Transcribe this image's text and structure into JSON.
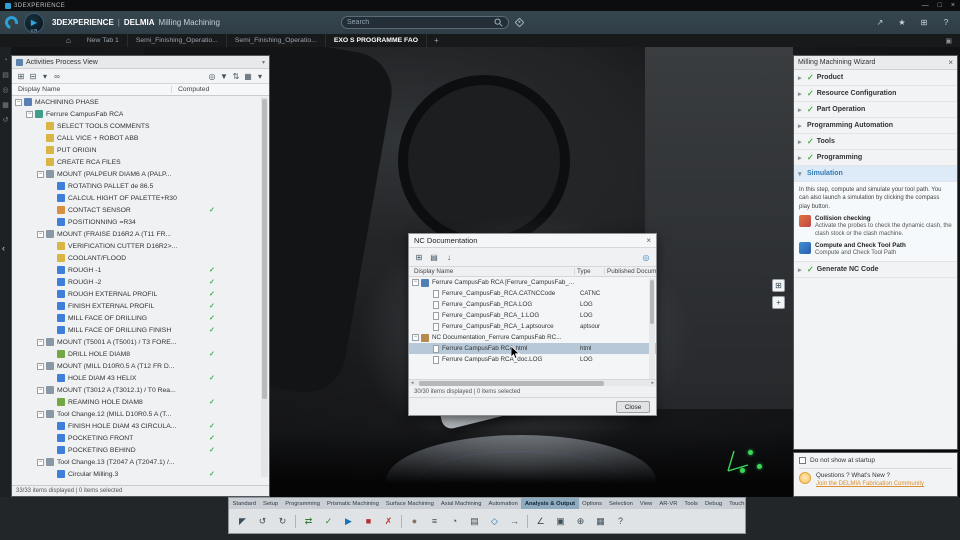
{
  "colors": {
    "accent": "#3a87c8",
    "check_green": "#3fae49",
    "selection": "#b7c9d8",
    "link_orange": "#d98e2b",
    "header_bg": "#37474f"
  },
  "titlebar": {
    "app_name": "3DEXPERIENCE",
    "window_controls": [
      {
        "name": "minimize-button",
        "glyph": "—"
      },
      {
        "name": "maximize-button",
        "glyph": "□"
      },
      {
        "name": "close-button",
        "glyph": "×"
      }
    ]
  },
  "header": {
    "brand": "3DEXPERIENCE",
    "separator": "|",
    "app": "DELMIA",
    "module": "Milling Machining",
    "compass_label": "V.R",
    "search_placeholder": "Search",
    "icons": [
      {
        "name": "share-icon",
        "glyph": "↗"
      },
      {
        "name": "favorites-icon",
        "glyph": "★"
      },
      {
        "name": "apps-grid-icon",
        "glyph": "⊞"
      },
      {
        "name": "help-icon",
        "glyph": "?"
      }
    ]
  },
  "tabbar": {
    "tabs": [
      {
        "label": "New Tab 1",
        "active": false
      },
      {
        "label": "Semi_Finishing_Operatio...",
        "active": false
      },
      {
        "label": "Semi_Finishing_Operatio...",
        "active": false
      },
      {
        "label": "EXO S PROGRAMME FAO",
        "active": true
      }
    ],
    "add_label": "+",
    "panel_toggle_glyph": "▣"
  },
  "edge_icons": [
    {
      "name": "compass-icon",
      "glyph": "◔"
    },
    {
      "name": "model-tree-icon",
      "glyph": "▤"
    },
    {
      "name": "search-panel-icon",
      "glyph": "◎"
    },
    {
      "name": "apps-panel-icon",
      "glyph": "▦"
    },
    {
      "name": "history-icon",
      "glyph": "↺"
    }
  ],
  "left_panel": {
    "title": "Activities Process View",
    "toolbar_left": [
      {
        "name": "insert-activity-icon",
        "glyph": "⊞"
      },
      {
        "name": "collapse-all-icon",
        "glyph": "⊟"
      },
      {
        "name": "view-mode-icon",
        "glyph": "▾"
      },
      {
        "name": "link-view-icon",
        "glyph": "∞"
      }
    ],
    "toolbar_right": [
      {
        "name": "search-icon",
        "glyph": "◎"
      },
      {
        "name": "filter-icon",
        "glyph": "▼"
      },
      {
        "name": "sort-icon",
        "glyph": "⇅"
      },
      {
        "name": "columns-icon",
        "glyph": "▦"
      },
      {
        "name": "panel-options-icon",
        "glyph": "▾"
      }
    ],
    "columns": {
      "display_name": "Display Name",
      "computed": "Computed"
    },
    "status": "33/33 items displayed | 0 items selected",
    "tree": [
      {
        "label": "MACHINING PHASE",
        "level": 0,
        "icon": "machining-phase-icon",
        "expand": true,
        "computed": false
      },
      {
        "label": "Ferrure CampusFab RCA",
        "level": 1,
        "icon": "program-icon",
        "expand": true,
        "computed": false
      },
      {
        "label": "SELECT TOOLS COMMENTS",
        "level": 2,
        "icon": "comment-icon",
        "expand": false,
        "computed": false
      },
      {
        "label": "CALL VICE + ROBOT ABB",
        "level": 2,
        "icon": "comment-icon",
        "expand": false,
        "computed": false
      },
      {
        "label": "PUT ORIGIN",
        "level": 2,
        "icon": "comment-icon",
        "expand": false,
        "computed": false
      },
      {
        "label": "CREATE RCA FILES",
        "level": 2,
        "icon": "comment-icon",
        "expand": false,
        "computed": false
      },
      {
        "label": "MOUNT (PALPEUR DIAM6 A (PALP...",
        "level": 2,
        "icon": "tool-change-icon",
        "expand": true,
        "computed": false
      },
      {
        "label": "ROTATING PALLET de 86.5",
        "level": 3,
        "icon": "operation-icon",
        "expand": false,
        "computed": false
      },
      {
        "label": "CALCUL HIGHT OF PALETTE+R30",
        "level": 3,
        "icon": "operation-icon",
        "expand": false,
        "computed": false
      },
      {
        "label": "CONTACT SENSOR",
        "level": 3,
        "icon": "probe-icon",
        "expand": false,
        "computed": true
      },
      {
        "label": "POSITIONNING =R34",
        "level": 3,
        "icon": "operation-icon",
        "expand": false,
        "computed": false
      },
      {
        "label": "MOUNT (FRAISE D16R2 A (T11 FR...",
        "level": 2,
        "icon": "tool-change-icon",
        "expand": true,
        "computed": false
      },
      {
        "label": "VERIFICATION CUTTER D16R2>...",
        "level": 3,
        "icon": "comment-icon",
        "expand": false,
        "computed": false
      },
      {
        "label": "COOLANT/FLOOD",
        "level": 3,
        "icon": "comment-icon",
        "expand": false,
        "computed": false
      },
      {
        "label": "ROUGH -1",
        "level": 3,
        "icon": "milling-icon",
        "expand": false,
        "computed": true
      },
      {
        "label": "ROUGH -2",
        "level": 3,
        "icon": "milling-icon",
        "expand": false,
        "computed": true
      },
      {
        "label": "ROUGH EXTERNAL PROFIL",
        "level": 3,
        "icon": "milling-icon",
        "expand": false,
        "computed": true
      },
      {
        "label": "FINISH EXTERNAL PROFIL",
        "level": 3,
        "icon": "milling-icon",
        "expand": false,
        "computed": true
      },
      {
        "label": "MILL FACE OF DRILLING",
        "level": 3,
        "icon": "milling-icon",
        "expand": false,
        "computed": true
      },
      {
        "label": "MILL FACE OF DRILLING FINISH",
        "level": 3,
        "icon": "milling-icon",
        "expand": false,
        "computed": true
      },
      {
        "label": "MOUNT (T5001 A (T5001) / T3 FORE...",
        "level": 2,
        "icon": "tool-change-icon",
        "expand": true,
        "computed": false
      },
      {
        "label": "DRILL HOLE DIAM8",
        "level": 3,
        "icon": "drill-icon",
        "expand": false,
        "computed": true
      },
      {
        "label": "MOUNT (MILL D10R0.5 A (T12 FR D...",
        "level": 2,
        "icon": "tool-change-icon",
        "expand": true,
        "computed": false
      },
      {
        "label": "HOLE DIAM 43 HELIX",
        "level": 3,
        "icon": "milling-icon",
        "expand": false,
        "computed": true
      },
      {
        "label": "MOUNT (T3012 A (T3012.1) / T0 Rea...",
        "level": 2,
        "icon": "tool-change-icon",
        "expand": true,
        "computed": false
      },
      {
        "label": "REAMING HOLE DIAM8",
        "level": 3,
        "icon": "drill-icon",
        "expand": false,
        "computed": true
      },
      {
        "label": "Tool Change.12 (MILL D10R0.5 A (T...",
        "level": 2,
        "icon": "tool-change-icon",
        "expand": true,
        "computed": false
      },
      {
        "label": "FINISH HOLE DIAM 43 CIRCULA...",
        "level": 3,
        "icon": "milling-icon",
        "expand": false,
        "computed": true
      },
      {
        "label": "POCKETING FRONT",
        "level": 3,
        "icon": "milling-icon",
        "expand": false,
        "computed": true
      },
      {
        "label": "POCKETING BEHIND",
        "level": 3,
        "icon": "milling-icon",
        "expand": false,
        "computed": true
      },
      {
        "label": "Tool Change.13 (T2047 A (T2047.1) /...",
        "level": 2,
        "icon": "tool-change-icon",
        "expand": true,
        "computed": false
      },
      {
        "label": "Circular Milling.3",
        "level": 3,
        "icon": "milling-icon",
        "expand": false,
        "computed": true
      }
    ]
  },
  "dialog": {
    "title": "NC Documentation",
    "toolbar": [
      {
        "name": "select-all-icon",
        "glyph": "⊞"
      },
      {
        "name": "open-document-icon",
        "glyph": "▤"
      },
      {
        "name": "download-icon",
        "glyph": "↓"
      }
    ],
    "search_icon": "◎",
    "columns": {
      "display_name": "Display Name",
      "type": "Type",
      "published": "Published Documen..."
    },
    "rows": [
      {
        "label": "Ferrure CampusFab RCA [Ferrure_CampusFab_...",
        "type": "",
        "level": 0,
        "icon": "nc-output-icon",
        "expand": true,
        "selected": false
      },
      {
        "label": "Ferrure_CampusFab_RCA.CATNCCode",
        "type": "CATNC",
        "level": 1,
        "icon": "document-icon",
        "expand": false,
        "selected": false
      },
      {
        "label": "Ferrure_CampusFab_RCA.LOG",
        "type": "LOG",
        "level": 1,
        "icon": "document-icon",
        "expand": false,
        "selected": false
      },
      {
        "label": "Ferrure_CampusFab_RCA_1.LOG",
        "type": "LOG",
        "level": 1,
        "icon": "document-icon",
        "expand": false,
        "selected": false
      },
      {
        "label": "Ferrure_CampusFab_RCA_1.aptsource",
        "type": "aptsour",
        "level": 1,
        "icon": "document-icon",
        "expand": false,
        "selected": false
      },
      {
        "label": "NC Documentation_Ferrure CampusFab RC...",
        "type": "",
        "level": 0,
        "icon": "nc-doc-icon",
        "expand": true,
        "selected": false
      },
      {
        "label": "Ferrure CampusFab RCA.html",
        "type": "html",
        "level": 1,
        "icon": "document-icon",
        "expand": false,
        "selected": true
      },
      {
        "label": "Ferrure CampusFab RCA_doc.LOG",
        "type": "LOG",
        "level": 1,
        "icon": "document-icon",
        "expand": false,
        "selected": false
      }
    ],
    "status": "30/30 items displayed | 0 items selected",
    "close_label": "Close"
  },
  "wizard": {
    "title": "Milling Machining Wizard",
    "steps": [
      {
        "label": "Product",
        "checked": true,
        "expanded": false
      },
      {
        "label": "Resource Configuration",
        "checked": true,
        "expanded": false
      },
      {
        "label": "Part Operation",
        "checked": true,
        "expanded": false
      },
      {
        "label": "Programming Automation",
        "checked": false,
        "expanded": false
      },
      {
        "label": "Tools",
        "checked": true,
        "expanded": false
      },
      {
        "label": "Programming",
        "checked": true,
        "expanded": false
      },
      {
        "label": "Simulation",
        "checked": false,
        "expanded": true
      },
      {
        "label": "Generate NC Code",
        "checked": true,
        "expanded": false
      }
    ],
    "simulation": {
      "intro": "In this step, compute and simulate your tool path. You can also launch a simulation by clicking the compass play button.",
      "items": [
        {
          "title": "Collision checking",
          "desc": "Activate the probes to check the dynamic clash, the clash stock or the clash machine.",
          "icon": "collision-checking-icon"
        },
        {
          "title": "Compute and Check Tool Path",
          "desc": "Compute and Check Tool Path",
          "icon": "compute-toolpath-icon"
        }
      ]
    }
  },
  "startup_panel": {
    "checkbox_label": "Do not show at startup",
    "question": "Questions ? What's New ?",
    "link": "Join the DELMIA Fabrication Community"
  },
  "action_bar": {
    "tabs": [
      {
        "label": "Standard",
        "active": false
      },
      {
        "label": "Setup",
        "active": false
      },
      {
        "label": "Programming",
        "active": false
      },
      {
        "label": "Prismatic Machining",
        "active": false
      },
      {
        "label": "Surface Machining",
        "active": false
      },
      {
        "label": "Axial Machining",
        "active": false
      },
      {
        "label": "Automation",
        "active": false
      },
      {
        "label": "Analysis & Output",
        "active": true
      },
      {
        "label": "Options",
        "active": false
      },
      {
        "label": "Selection",
        "active": false
      },
      {
        "label": "View",
        "active": false
      },
      {
        "label": "AR-VR",
        "active": false
      },
      {
        "label": "Tools",
        "active": false
      },
      {
        "label": "Debug",
        "active": false
      },
      {
        "label": "Touch",
        "active": false
      }
    ],
    "icons": [
      {
        "name": "select-icon",
        "glyph": "◤"
      },
      {
        "name": "undo-icon",
        "glyph": "↺"
      },
      {
        "name": "redo-icon",
        "glyph": "↻"
      },
      {
        "divider": true
      },
      {
        "name": "update-icon",
        "glyph": "⇄",
        "color": "#2e7d32"
      },
      {
        "name": "compute-toolpath-icon",
        "glyph": "✓",
        "color": "#2e8b3d"
      },
      {
        "name": "simulate-play-icon",
        "glyph": "▶",
        "color": "#1b74b8"
      },
      {
        "name": "stop-simulation-icon",
        "glyph": "■",
        "color": "#b03030"
      },
      {
        "name": "collision-check-icon",
        "glyph": "✗",
        "color": "#c0392b"
      },
      {
        "divider": true
      },
      {
        "name": "material-removal-icon",
        "glyph": "●",
        "color": "#8d6e63"
      },
      {
        "name": "gantt-chart-icon",
        "glyph": "≡"
      },
      {
        "name": "time-analysis-icon",
        "glyph": "◔"
      },
      {
        "name": "nc-documentation-icon",
        "glyph": "▤"
      },
      {
        "name": "nc-code-output-icon",
        "glyph": "◇",
        "color": "#1b74b8"
      },
      {
        "name": "post-processor-icon",
        "glyph": "→"
      },
      {
        "divider": true
      },
      {
        "name": "measure-icon",
        "glyph": "∠"
      },
      {
        "name": "section-view-icon",
        "glyph": "▣"
      },
      {
        "name": "zoom-area-icon",
        "glyph": "⊕"
      },
      {
        "name": "view-settings-icon",
        "glyph": "▦"
      },
      {
        "name": "help-icon",
        "glyph": "?"
      }
    ]
  },
  "viewport": {
    "mini_buttons": [
      {
        "name": "view-manipulation-icon",
        "glyph": "⊞"
      },
      {
        "name": "reframe-icon",
        "glyph": "+"
      }
    ]
  }
}
